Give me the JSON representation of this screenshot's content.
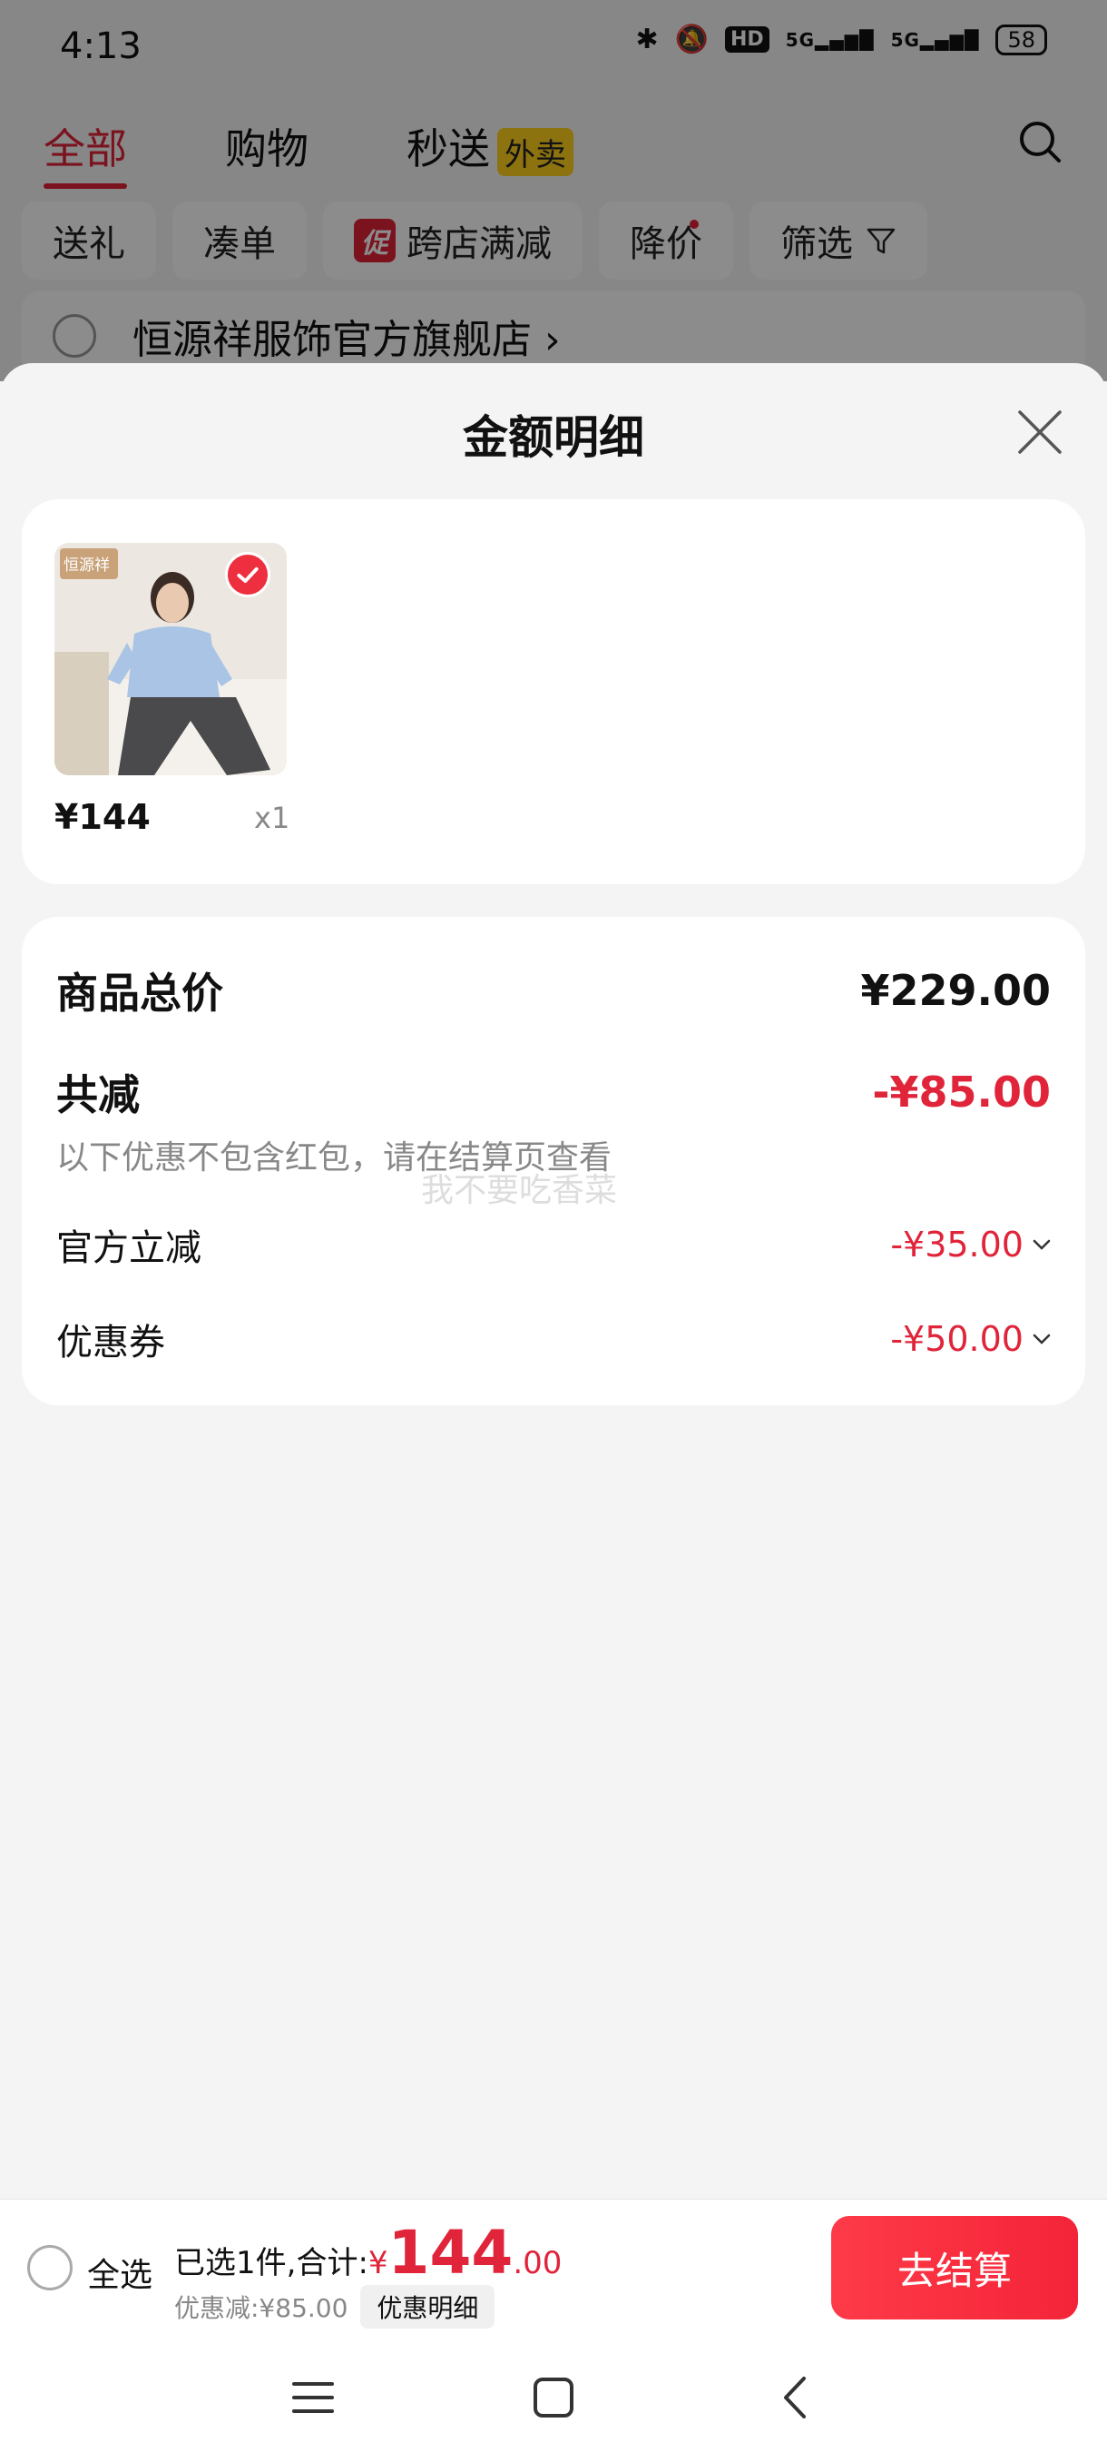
{
  "status_bar": {
    "time": "4:13",
    "hd": "HD",
    "net1": "5G",
    "net2": "5G",
    "battery": "58"
  },
  "tabs": [
    {
      "label": "全部"
    },
    {
      "label": "购物"
    },
    {
      "label": "秒送",
      "badge": "外卖"
    }
  ],
  "filters": {
    "gift": "送礼",
    "bundle": "凑单",
    "promo_tag": "促",
    "cross_store": "跨店满减",
    "price_drop": "降价",
    "filter": "筛选"
  },
  "store": {
    "name": "恒源祥服饰官方旗舰店",
    "arrow": "›"
  },
  "sheet": {
    "title": "金额明细",
    "product": {
      "brand_tag": "恒源祥",
      "price": "¥144",
      "qty": "x1"
    },
    "summary": {
      "total_label": "商品总价",
      "total_value": "¥229.00",
      "reduce_label": "共减",
      "reduce_value": "-¥85.00",
      "note": "以下优惠不包含红包，请在结算页查看",
      "official_label": "官方立减",
      "official_value": "-¥35.00",
      "coupon_label": "优惠券",
      "coupon_value": "-¥50.00",
      "watermark": "我不要吃香菜"
    }
  },
  "checkout": {
    "select_all": "全选",
    "selected_text": "已选1件,合计:",
    "currency": "¥",
    "total_int": "144",
    "total_dec": ".00",
    "discount_text": "优惠减:¥85.00",
    "detail_button": "优惠明细",
    "checkout_button": "去结算"
  },
  "colors": {
    "accent": "#e0243a",
    "button": "#f42438",
    "badge_yellow": "#ffd21e"
  }
}
